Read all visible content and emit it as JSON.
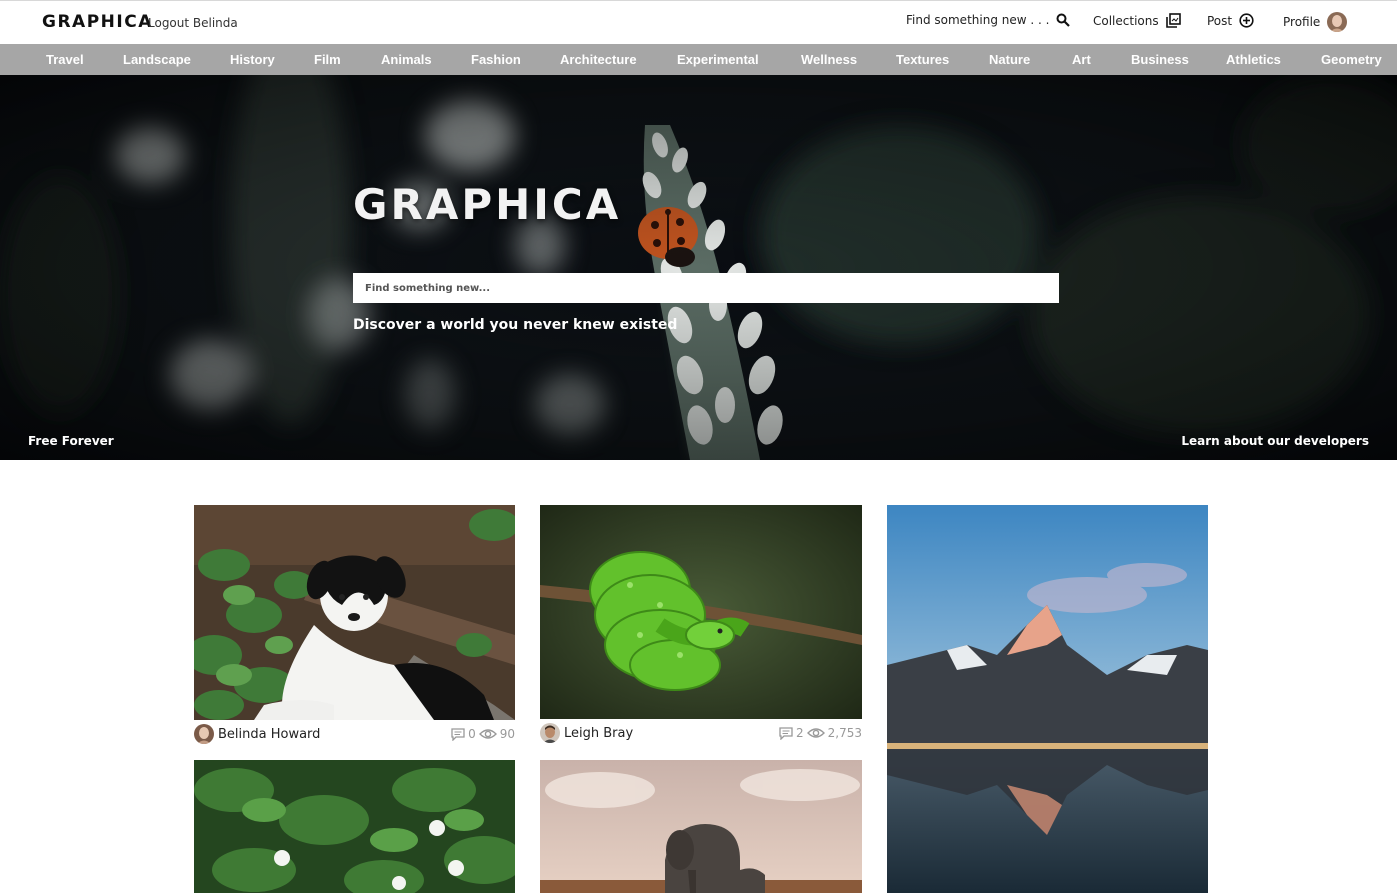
{
  "header": {
    "logo": "GRAPHICA",
    "logout_label": "Logout Belinda",
    "search_label": "Find something new . . .",
    "collections_label": "Collections",
    "post_label": "Post",
    "profile_label": "Profile"
  },
  "categories": [
    "Travel",
    "Landscape",
    "History",
    "Film",
    "Animals",
    "Fashion",
    "Architecture",
    "Experimental",
    "Wellness",
    "Textures",
    "Nature",
    "Art",
    "Business",
    "Athletics",
    "Geometry"
  ],
  "hero": {
    "logo": "GRAPHICA",
    "search_placeholder": "Find something new...",
    "tagline": "Discover a world you never knew existed",
    "free_label": "Free Forever",
    "developers_link": "Learn about our developers"
  },
  "posts": [
    {
      "author": "Belinda Howard",
      "comments": "0",
      "views": "90",
      "subject": "puppy"
    },
    {
      "author": "Leigh Bray",
      "comments": "2",
      "views": "2,753",
      "subject": "green snake"
    },
    {
      "subject": "mountain lake"
    },
    {
      "subject": "white flowers"
    },
    {
      "subject": "elephant"
    }
  ],
  "colors": {
    "category_bar": "#a6a6a6",
    "hero_background": "#07090d",
    "stats_gray": "#999999"
  }
}
